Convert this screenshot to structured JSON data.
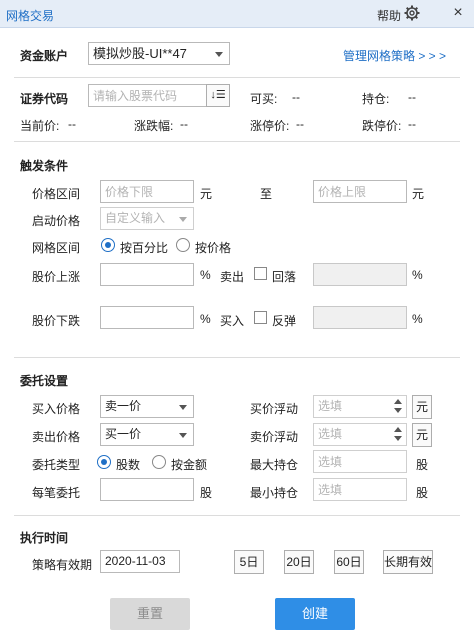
{
  "window": {
    "title": "网格交易",
    "help": "帮助",
    "close_glyph": "×"
  },
  "account": {
    "label": "资金账户",
    "selected": "模拟炒股-UI**47",
    "manage_link": "管理网格策略 > > >"
  },
  "security": {
    "code_label": "证券代码",
    "code_placeholder": "请输入股票代码",
    "sort_glyph": "↓☰",
    "can_buy_label": "可买:",
    "can_buy_value": "--",
    "holding_label": "持仓:",
    "holding_value": "--",
    "price_label": "当前价:",
    "price_value": "--",
    "change_label": "涨跌幅:",
    "change_value": "--",
    "limit_up_label": "涨停价:",
    "limit_up_value": "--",
    "limit_down_label": "跌停价:",
    "limit_down_value": "--"
  },
  "trigger": {
    "section_title": "触发条件",
    "price_range_label": "价格区间",
    "lower_placeholder": "价格下限",
    "unit_yuan": "元",
    "to_label": "至",
    "upper_placeholder": "价格上限",
    "start_price_label": "启动价格",
    "start_price_selected": "自定义输入",
    "grid_range_label": "网格区间",
    "by_percent": "按百分比",
    "by_price": "按价格",
    "rise_label": "股价上涨",
    "fall_label": "股价下跌",
    "percent": "%",
    "sell_label": "卖出",
    "pullback_label": "回落",
    "buy_label": "买入",
    "rebound_label": "反弹"
  },
  "order": {
    "section_title": "委托设置",
    "buy_price_label": "买入价格",
    "buy_price_selected": "卖一价",
    "sell_price_label": "卖出价格",
    "sell_price_selected": "买一价",
    "buy_float_label": "买价浮动",
    "sell_float_label": "卖价浮动",
    "optional_placeholder": "选填",
    "yuan_button": "元",
    "type_label": "委托类型",
    "by_shares": "股数",
    "by_amount": "按金额",
    "max_hold_label": "最大持仓",
    "min_hold_label": "最小持仓",
    "unit_share": "股",
    "each_label": "每笔委托"
  },
  "exec": {
    "section_title": "执行时间",
    "validity_label": "策略有效期",
    "date_value": "2020-11-03",
    "opt_5": "5日",
    "opt_20": "20日",
    "opt_60": "60日",
    "opt_long": "长期有效"
  },
  "actions": {
    "reset": "重置",
    "create": "创建"
  },
  "colors": {
    "accent": "#1f6fc6",
    "create_bg": "#2f8ee6",
    "reset_bg": "#d9d9d9"
  }
}
